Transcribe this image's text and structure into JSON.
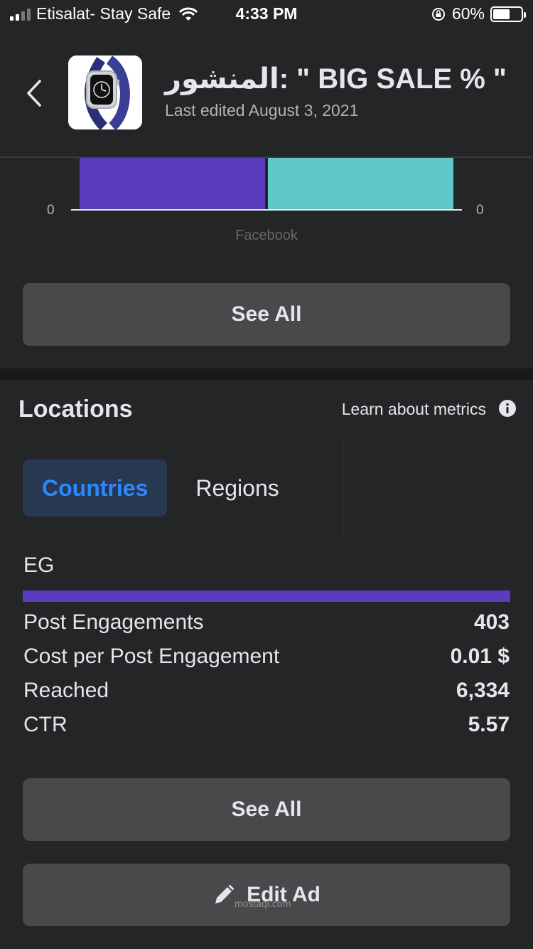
{
  "status_bar": {
    "carrier": "Etisalat- Stay Safe",
    "time": "4:33 PM",
    "battery_percent": "60%",
    "battery_level": 0.6,
    "icons": [
      "signal-icon",
      "wifi-icon",
      "orientation-lock-icon",
      "battery-charging-icon"
    ]
  },
  "header": {
    "title": "المنشور: \" BIG SALE % \"",
    "subtitle": "Last edited August 3, 2021",
    "back_icon": "chevron-left-icon",
    "thumbnail_icon": "smartwatch-image"
  },
  "chart_data": {
    "type": "bar",
    "categories": [
      "Facebook"
    ],
    "series": [
      {
        "values": [
          0
        ],
        "color": "#5a3dbf"
      },
      {
        "values": [
          0
        ],
        "color": "#5ec8c8"
      }
    ],
    "left_axis_tick": "0",
    "right_axis_tick": "0",
    "xlabel": "Facebook"
  },
  "see_all_top": {
    "label": "See All"
  },
  "locations": {
    "title": "Locations",
    "learn_link": "Learn about metrics",
    "info_icon": "info-icon",
    "tabs": [
      {
        "label": "Countries",
        "active": true
      },
      {
        "label": "Regions",
        "active": false
      }
    ],
    "country": "EG",
    "country_share": 1.0,
    "bar_color": "#5a3dbf",
    "metrics": [
      {
        "label": "Post Engagements",
        "value": "403"
      },
      {
        "label": "Cost per Post Engagement",
        "value": "0.01 $"
      },
      {
        "label": "Reached",
        "value": "6,334"
      },
      {
        "label": "CTR",
        "value": "5.57"
      }
    ]
  },
  "see_all_bottom": {
    "label": "See All"
  },
  "edit_ad": {
    "label": "Edit Ad",
    "icon": "pencil-icon"
  },
  "watermark": "mostaql.com"
}
